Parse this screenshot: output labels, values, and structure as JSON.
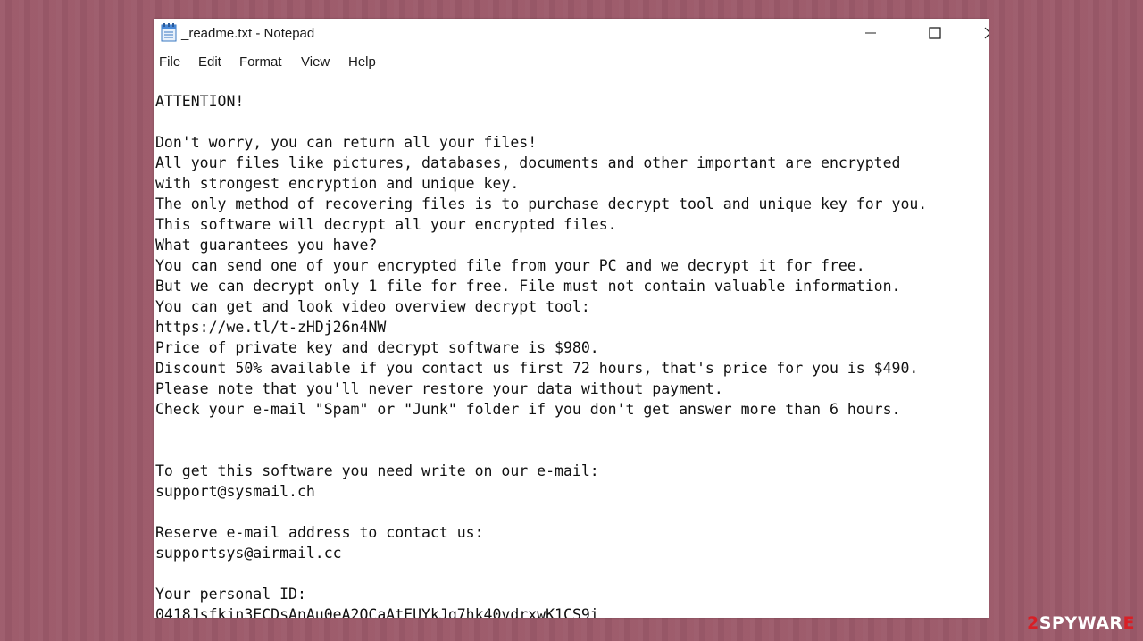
{
  "window": {
    "title": "_readme.txt - Notepad"
  },
  "menu": {
    "file": "File",
    "edit": "Edit",
    "format": "Format",
    "view": "View",
    "help": "Help"
  },
  "editor": {
    "lines": [
      "ATTENTION!",
      "",
      "Don't worry, you can return all your files!",
      "All your files like pictures, databases, documents and other important are encrypted",
      "with strongest encryption and unique key.",
      "The only method of recovering files is to purchase decrypt tool and unique key for you.",
      "This software will decrypt all your encrypted files.",
      "What guarantees you have?",
      "You can send one of your encrypted file from your PC and we decrypt it for free.",
      "But we can decrypt only 1 file for free. File must not contain valuable information.",
      "You can get and look video overview decrypt tool:",
      "https://we.tl/t-zHDj26n4NW",
      "Price of private key and decrypt software is $980.",
      "Discount 50% available if you contact us first 72 hours, that's price for you is $490.",
      "Please note that you'll never restore your data without payment.",
      "Check your e-mail \"Spam\" or \"Junk\" folder if you don't get answer more than 6 hours.",
      "",
      "",
      "To get this software you need write on our e-mail:",
      "support@sysmail.ch",
      "",
      "Reserve e-mail address to contact us:",
      "supportsys@airmail.cc",
      "",
      "Your personal ID:",
      "0418Jsfkjn3ECDsAnAu0eA2QCaAtEUYkJq7hk40vdrxwK1CS9i"
    ]
  },
  "watermark": {
    "prefix": "2",
    "text": "SPYWAR",
    "suffix": "E"
  },
  "colors": {
    "background": "#9c5a6a",
    "watermark_accent": "#d81f26"
  }
}
